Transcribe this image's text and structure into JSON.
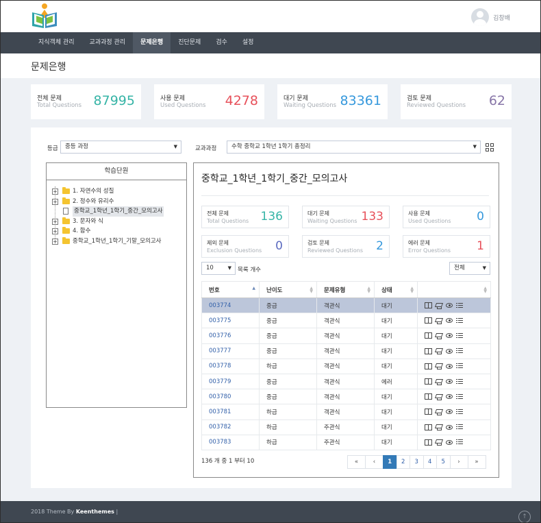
{
  "user": {
    "name": "김창배"
  },
  "nav": [
    "지식객체 관리",
    "교과과정 관리",
    "문제은행",
    "진단문제",
    "검수",
    "설정"
  ],
  "page_title": "문제은행",
  "stats": [
    {
      "label": "전체 문제",
      "sub": "Total Questions",
      "value": "87995",
      "color": "#36b4a6"
    },
    {
      "label": "사용 문제",
      "sub": "Used Questions",
      "value": "4278",
      "color": "#e7505a"
    },
    {
      "label": "대기 문제",
      "sub": "Waiting Questions",
      "value": "83361",
      "color": "#3598dc"
    },
    {
      "label": "검토 문제",
      "sub": "Reviewed Questions",
      "value": "62",
      "color": "#8775a7"
    }
  ],
  "filters": {
    "grade_label": "등급",
    "grade_value": "중등 과정",
    "course_label": "교과과정",
    "course_value": "수학 중학교 1학년 1학기 총정리"
  },
  "tree": {
    "title": "학습단원",
    "items": [
      "1. 자연수의 성질",
      "2. 정수와 유리수",
      "중학교_1학년_1학기_중간_모의고사",
      "3. 문자와 식",
      "4. 함수",
      "중학교_1학년_1학기_기말_모의고사"
    ]
  },
  "detail": {
    "title": "중학교_1학년_1학기_중간_모의고사",
    "cards": [
      {
        "label": "전체 문제",
        "sub": "Total Questions",
        "value": "136",
        "color": "#36b4a6"
      },
      {
        "label": "대기 문제",
        "sub": "Waiting Questions",
        "value": "133",
        "color": "#e7505a"
      },
      {
        "label": "사용 문제",
        "sub": "Used Questions",
        "value": "0",
        "color": "#3598dc"
      },
      {
        "label": "제외 문제",
        "sub": "Exclusion Questions",
        "value": "0",
        "color": "#5c6bc0"
      },
      {
        "label": "검토 문제",
        "sub": "Reviewed Questions",
        "value": "2",
        "color": "#3598dc"
      },
      {
        "label": "에러 문제",
        "sub": "Error Questions",
        "value": "1",
        "color": "#e7505a"
      }
    ],
    "page_size": "10",
    "page_size_label": "목록 개수",
    "filter_value": "전체",
    "columns": [
      "번호",
      "난이도",
      "문제유형",
      "상태"
    ],
    "rows": [
      [
        "003774",
        "중급",
        "객관식",
        "대기"
      ],
      [
        "003775",
        "중급",
        "객관식",
        "대기"
      ],
      [
        "003776",
        "중급",
        "객관식",
        "대기"
      ],
      [
        "003777",
        "중급",
        "객관식",
        "대기"
      ],
      [
        "003778",
        "하급",
        "객관식",
        "대기"
      ],
      [
        "003779",
        "중급",
        "객관식",
        "에러"
      ],
      [
        "003780",
        "중급",
        "객관식",
        "대기"
      ],
      [
        "003781",
        "하급",
        "객관식",
        "대기"
      ],
      [
        "003782",
        "하급",
        "주관식",
        "대기"
      ],
      [
        "003783",
        "하급",
        "주관식",
        "대기"
      ]
    ],
    "info": "136 개 중 1 부터 10",
    "pager": [
      "«",
      "‹",
      "1",
      "2",
      "3",
      "4",
      "5",
      "›",
      "»"
    ]
  },
  "footer": {
    "prefix": "2018 Theme By",
    "brand": "Keenthemes",
    "suffix": "|"
  }
}
